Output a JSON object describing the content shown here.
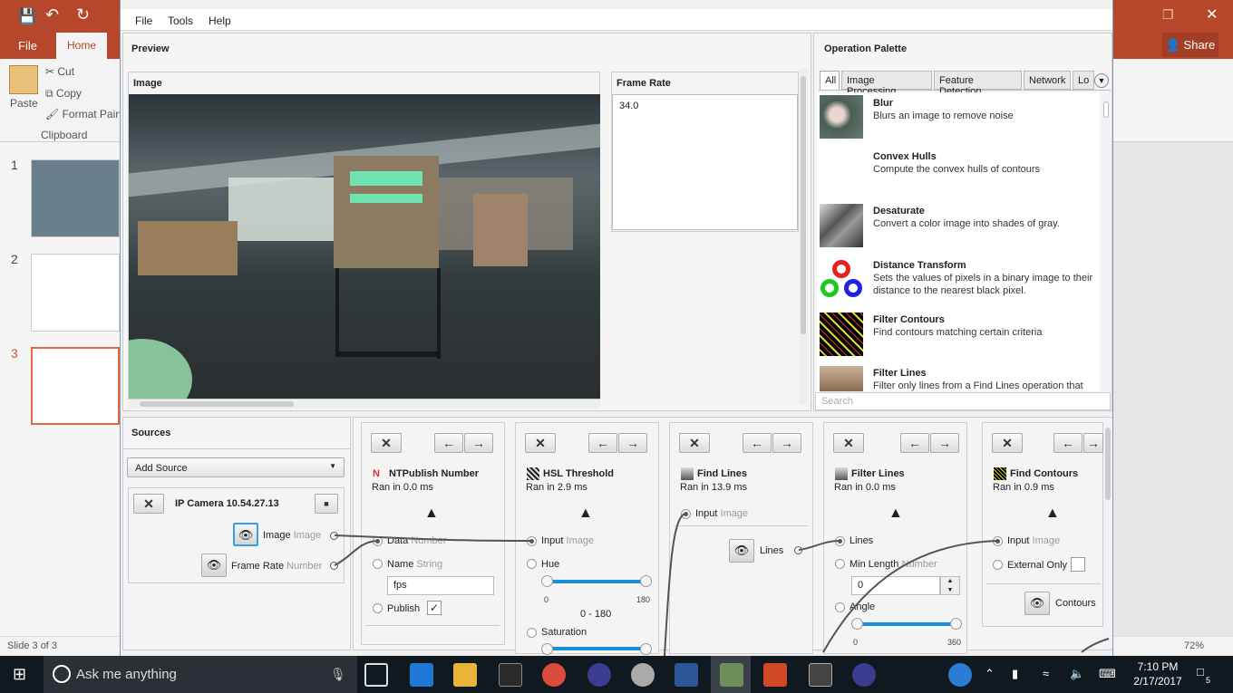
{
  "ppt": {
    "tabs": {
      "file": "File",
      "home": "Home"
    },
    "share": "Share",
    "clipboard": {
      "paste": "Paste",
      "cut": "Cut",
      "copy": "Copy",
      "format_painter": "Format Pain",
      "group": "Clipboard"
    },
    "slide_numbers": [
      "1",
      "2",
      "3"
    ],
    "status": {
      "slide": "Slide 3 of 3",
      "zoom": "72%"
    }
  },
  "menu": {
    "file": "File",
    "tools": "Tools",
    "help": "Help"
  },
  "preview": {
    "title": "Preview",
    "image_label": "Image",
    "frame_rate_label": "Frame Rate",
    "frame_rate_value": "34.0"
  },
  "palette": {
    "title": "Operation Palette",
    "tabs": [
      "All",
      "Image Processing",
      "Feature Detection",
      "Network",
      "Lo"
    ],
    "ops": [
      {
        "name": "Blur",
        "desc": "Blurs an image to remove noise"
      },
      {
        "name": "Convex Hulls",
        "desc": "Compute the convex hulls of contours"
      },
      {
        "name": "Desaturate",
        "desc": "Convert a color image into shades of gray."
      },
      {
        "name": "Distance Transform",
        "desc": "Sets the values of pixels in a binary image to their distance to the nearest black pixel."
      },
      {
        "name": "Filter Contours",
        "desc": "Find contours matching certain criteria"
      },
      {
        "name": "Filter Lines",
        "desc": "Filter only lines from a Find Lines operation that"
      }
    ],
    "search_placeholder": "Search"
  },
  "sources": {
    "title": "Sources",
    "add_source": "Add Source",
    "camera_name": "IP Camera 10.54.27.13",
    "outputs": [
      {
        "name": "Image",
        "type": "Image"
      },
      {
        "name": "Frame Rate",
        "type": "Number"
      }
    ]
  },
  "steps": {
    "ntpublish": {
      "title": "NTPublish Number",
      "ran": "Ran in 0.0 ms",
      "data": "Data",
      "data_type": "Number",
      "name": "Name",
      "name_type": "String",
      "name_value": "fps",
      "publish": "Publish"
    },
    "hsl": {
      "title": "HSL Threshold",
      "ran": "Ran in 2.9 ms",
      "input": "Input",
      "input_type": "Image",
      "hue": "Hue",
      "hue_min": "0",
      "hue_max": "180",
      "hue_range": "0 - 180",
      "hue_low_frac": 0,
      "hue_high_frac": 1,
      "saturation": "Saturation"
    },
    "findlines": {
      "title": "Find Lines",
      "ran": "Ran in 13.9 ms",
      "input": "Input",
      "input_type": "Image",
      "lines": "Lines"
    },
    "filterlines": {
      "title": "Filter Lines",
      "ran": "Ran in 0.0 ms",
      "lines": "Lines",
      "min_length": "Min Length",
      "min_length_type": "Number",
      "min_length_value": "0",
      "angle": "Angle",
      "angle_min": "0",
      "angle_max": "360"
    },
    "findcontours": {
      "title": "Find Contours",
      "ran": "Ran in 0.9 ms",
      "input": "Input",
      "input_type": "Image",
      "external_only": "External Only",
      "contours": "Contours"
    }
  },
  "taskbar": {
    "search": "Ask me anything",
    "time": "7:10 PM",
    "date": "2/17/2017",
    "notifications": "5"
  }
}
